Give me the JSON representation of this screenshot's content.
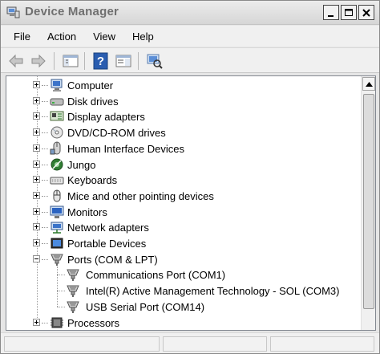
{
  "window": {
    "title": "Device Manager"
  },
  "menubar": {
    "items": [
      "File",
      "Action",
      "View",
      "Help"
    ]
  },
  "toolbar": {
    "buttons": [
      "back-arrow-icon",
      "forward-arrow-icon",
      "console-tree-icon",
      "help-icon",
      "properties-icon",
      "scan-hardware-icon"
    ]
  },
  "tree": {
    "items": [
      {
        "label": "Computer",
        "icon": "computer-icon",
        "expanded": false
      },
      {
        "label": "Disk drives",
        "icon": "disk-drive-icon",
        "expanded": false
      },
      {
        "label": "Display adapters",
        "icon": "display-adapter-icon",
        "expanded": false
      },
      {
        "label": "DVD/CD-ROM drives",
        "icon": "dvd-drive-icon",
        "expanded": false
      },
      {
        "label": "Human Interface Devices",
        "icon": "hid-icon",
        "expanded": false
      },
      {
        "label": "Jungo",
        "icon": "jungo-icon",
        "expanded": false
      },
      {
        "label": "Keyboards",
        "icon": "keyboard-icon",
        "expanded": false
      },
      {
        "label": "Mice and other pointing devices",
        "icon": "mouse-icon",
        "expanded": false
      },
      {
        "label": "Monitors",
        "icon": "monitor-icon",
        "expanded": false
      },
      {
        "label": "Network adapters",
        "icon": "network-adapter-icon",
        "expanded": false
      },
      {
        "label": "Portable Devices",
        "icon": "portable-device-icon",
        "expanded": false
      },
      {
        "label": "Ports (COM & LPT)",
        "icon": "port-icon",
        "expanded": true,
        "children": [
          {
            "label": "Communications Port (COM1)",
            "icon": "port-icon"
          },
          {
            "label": "Intel(R) Active Management Technology - SOL (COM3)",
            "icon": "port-icon"
          },
          {
            "label": "USB Serial Port (COM14)",
            "icon": "port-icon"
          }
        ]
      },
      {
        "label": "Processors",
        "icon": "processor-icon",
        "expanded": false
      }
    ]
  },
  "colors": {
    "tree_background": "#ffffff",
    "chrome": "#f0f0f0",
    "accent_blue": "#1f5fbf"
  }
}
